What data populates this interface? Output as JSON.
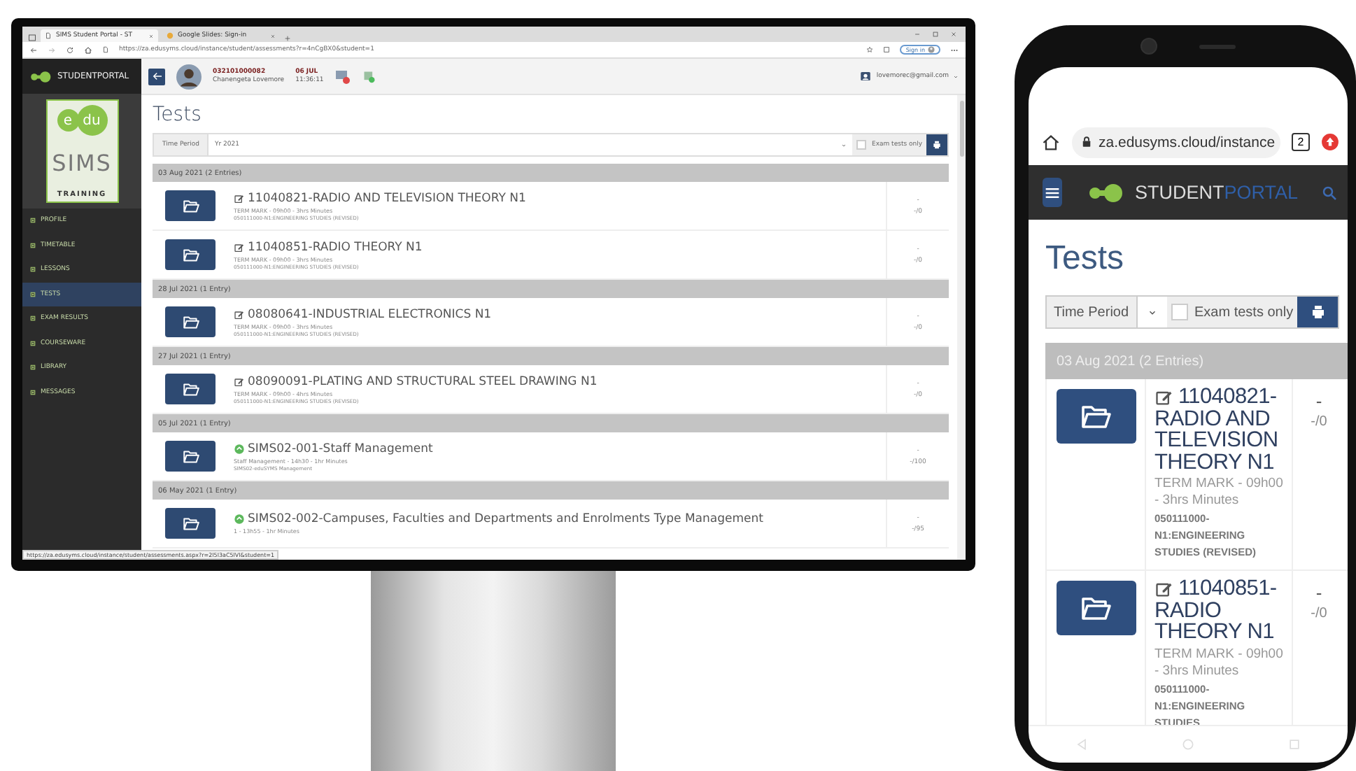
{
  "desktop": {
    "browser": {
      "tabs": [
        {
          "label": "SIMS Student Portal - ST",
          "selected": true
        },
        {
          "label": "Google Slides: Sign-in",
          "selected": false
        }
      ],
      "url": "https://za.edusyms.cloud/instance/student/assessments?r=4nCgBX0&student=1",
      "sign_in": "Sign in"
    },
    "sidebar": {
      "brand": "STUDENTPORTAL",
      "logo": {
        "top_left": "e",
        "top_right": "du",
        "middle": "SIMS",
        "bottom": "TRAINING"
      },
      "items": [
        {
          "label": "PROFILE",
          "selected": false
        },
        {
          "label": "TIMETABLE",
          "selected": false
        },
        {
          "label": "LESSONS",
          "selected": false
        },
        {
          "label": "TESTS",
          "selected": true
        },
        {
          "label": "EXAM RESULTS",
          "selected": false
        },
        {
          "label": "COURSEWARE",
          "selected": false
        },
        {
          "label": "LIBRARY",
          "selected": false
        },
        {
          "label": "MESSAGES",
          "selected": false
        }
      ]
    },
    "header": {
      "student_number": "032101000082",
      "student_name": "Chanengeta Lovemore",
      "date": "06 JUL",
      "time": "11:36:11",
      "user_email": "lovemorec@gmail.com"
    },
    "title": "Tests",
    "filter": {
      "label": "Time Period",
      "value": "Yr 2021",
      "exam_only": {
        "label": "Exam tests only",
        "checked": false
      }
    },
    "groups": [
      {
        "heading": "03 Aug 2021 (2 Entries)",
        "tests": [
          {
            "kind": "edit",
            "title": "11040821-RADIO AND TELEVISION THEORY N1",
            "detail": "TERM MARK - 09h00 - 3hrs Minutes",
            "course": "050111000-N1:ENGINEERING STUDIES (REVISED)",
            "mark": "-",
            "total": "-/0"
          },
          {
            "kind": "edit",
            "title": "11040851-RADIO THEORY N1",
            "detail": "TERM MARK - 09h00 - 3hrs Minutes",
            "course": "050111000-N1:ENGINEERING STUDIES (REVISED)",
            "mark": "-",
            "total": "-/0"
          }
        ]
      },
      {
        "heading": "28 Jul 2021 (1 Entry)",
        "tests": [
          {
            "kind": "edit",
            "title": "08080641-INDUSTRIAL ELECTRONICS N1",
            "detail": "TERM MARK - 09h00 - 3hrs Minutes",
            "course": "050111000-N1:ENGINEERING STUDIES (REVISED)",
            "mark": "-",
            "total": "-/0"
          }
        ]
      },
      {
        "heading": "27 Jul 2021 (1 Entry)",
        "tests": [
          {
            "kind": "edit",
            "title": "08090091-PLATING AND STRUCTURAL STEEL DRAWING N1",
            "detail": "TERM MARK - 09h00 - 4hrs Minutes",
            "course": "050111000-N1:ENGINEERING STUDIES (REVISED)",
            "mark": "-",
            "total": "-/0"
          }
        ]
      },
      {
        "heading": "05 Jul 2021 (1 Entry)",
        "tests": [
          {
            "kind": "info",
            "title": "SIMS02-001-Staff Management",
            "detail": "Staff Management - 14h30 - 1hr Minutes",
            "course": "SIMS02-eduSYMS Management",
            "mark": "-",
            "total": "-/100"
          }
        ]
      },
      {
        "heading": "06 May 2021 (1 Entry)",
        "tests": [
          {
            "kind": "info",
            "title": "SIMS02-002-Campuses, Faculties and Departments and Enrolments Type Management",
            "detail": "1 - 13h55 - 1hr Minutes",
            "mark": "-",
            "total": "-/95"
          }
        ]
      }
    ],
    "status_url": "https://za.edusyms.cloud/instance/student/assessments.aspx?r=2l5l3aC5lVl&student=1"
  },
  "phone": {
    "url": "za.edusyms.cloud/instance",
    "tab_count": "2",
    "brand_words": [
      "STUDENT",
      "PORTAL"
    ],
    "title": "Tests",
    "filter": {
      "label": "Time Period",
      "exam_only": {
        "label": "Exam tests only",
        "checked": false
      }
    },
    "groups": [
      {
        "heading": "03 Aug 2021 (2 Entries)",
        "tests": [
          {
            "kind": "edit",
            "title": "11040821-RADIO AND TELEVISION THEORY N1",
            "detail": "TERM MARK - 09h00 - 3hrs Minutes",
            "course": "050111000-N1:ENGINEERING STUDIES (REVISED)",
            "mark": "-",
            "total": "-/0"
          },
          {
            "kind": "edit",
            "title": "11040851-RADIO THEORY N1",
            "detail": "TERM MARK - 09h00 - 3hrs Minutes",
            "course": "050111000-N1:ENGINEERING STUDIES",
            "mark": "-",
            "total": "-/0"
          }
        ]
      }
    ]
  }
}
